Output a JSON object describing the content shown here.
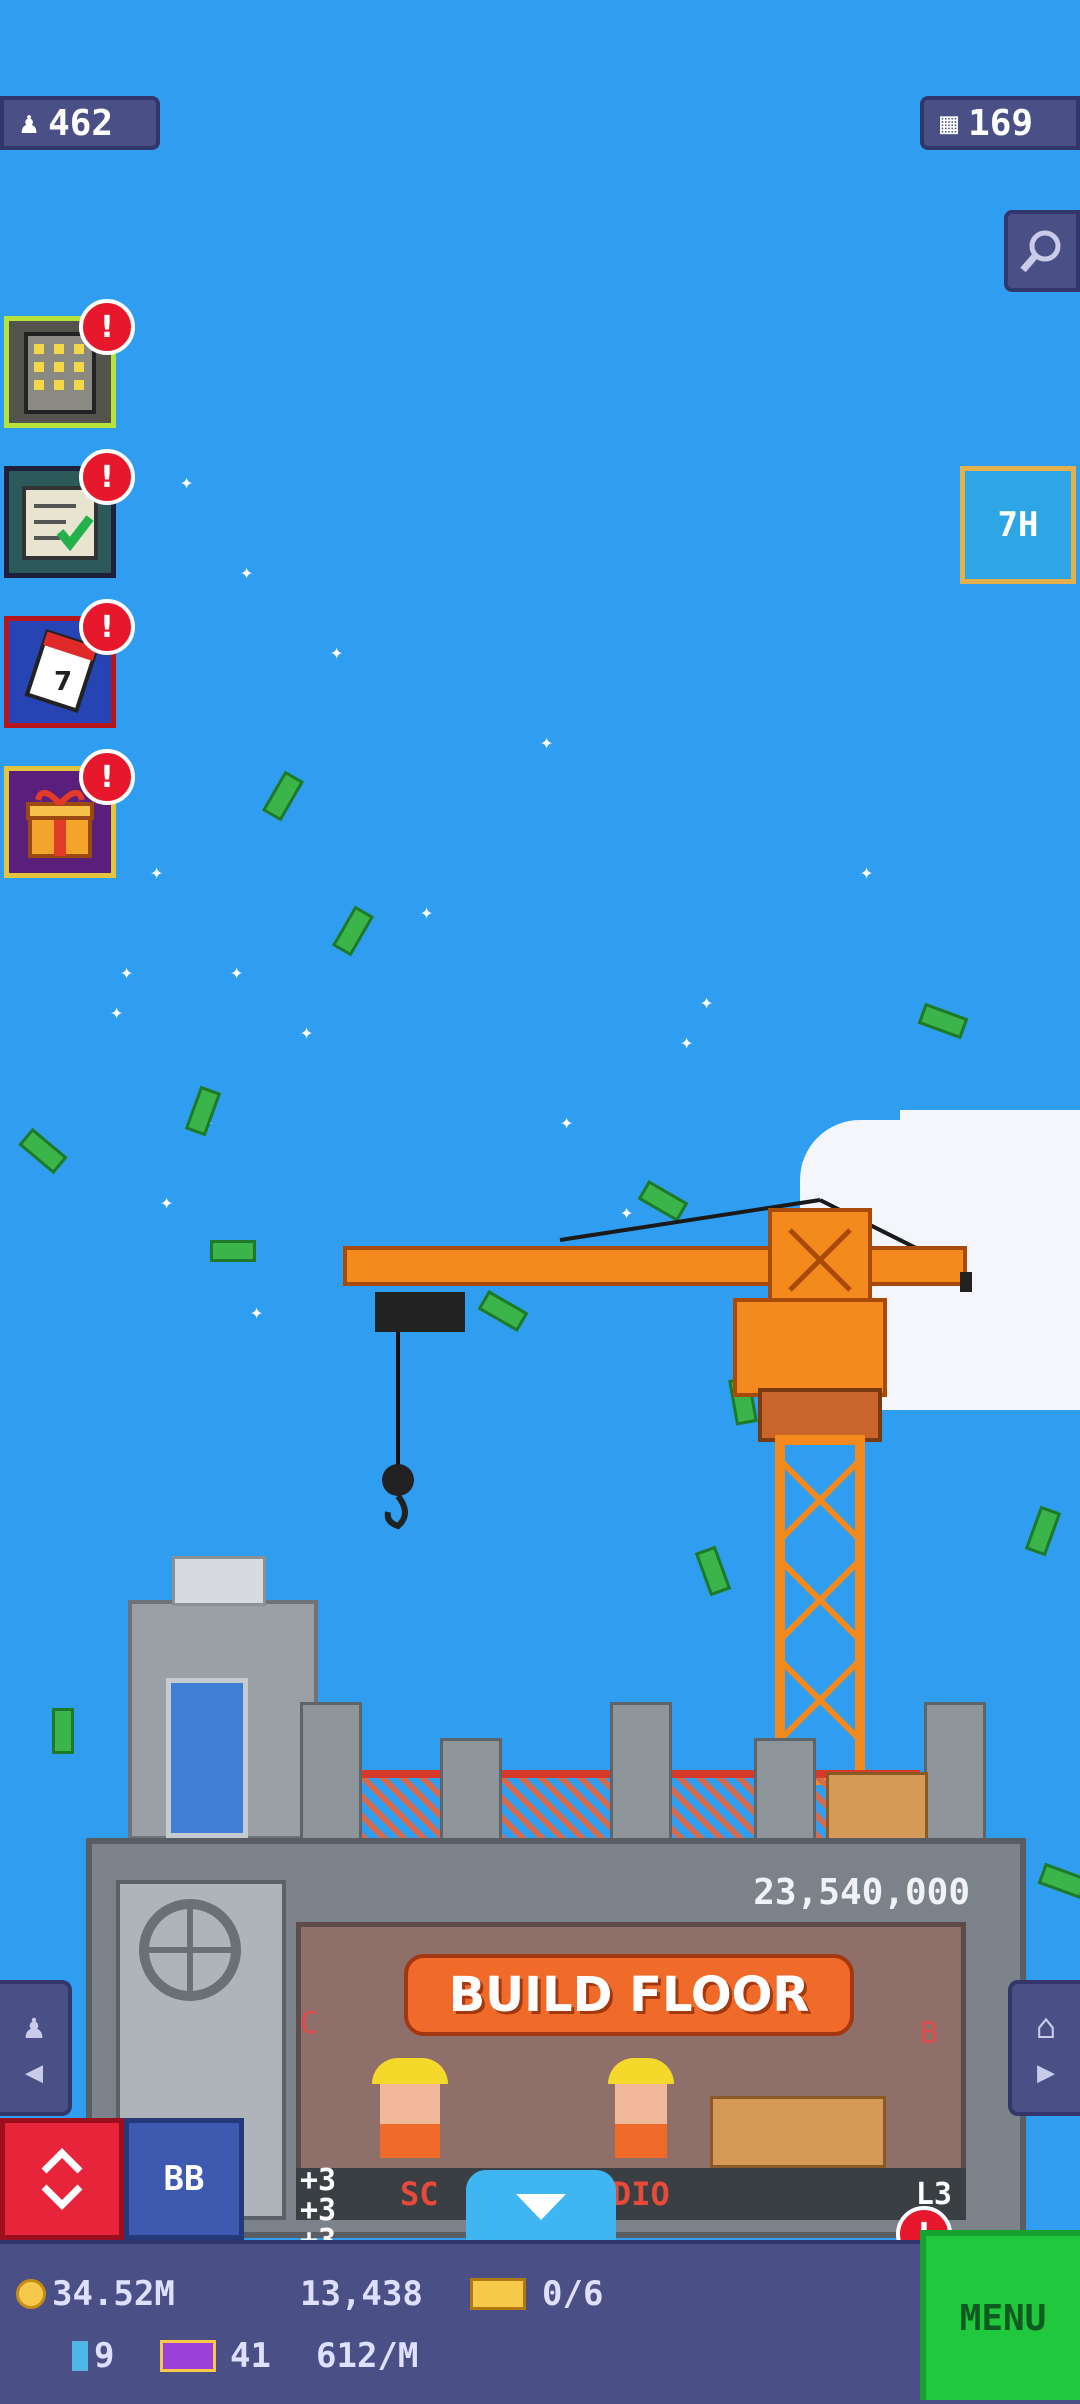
{
  "top": {
    "residents": "462",
    "floors": "169",
    "timer_label": "7H"
  },
  "build": {
    "cost": "23,540,000",
    "button_label": "BUILD FLOOR",
    "floor_label": "SC    S STUDIO",
    "floor_level": "L3",
    "left_letter": "C",
    "right_letter": "B"
  },
  "popups": [
    "+3",
    "+3",
    "+3"
  ],
  "elevator": {
    "label": "BB"
  },
  "bottom": {
    "coins": "34.52M",
    "bux": "13,438",
    "golden": "0/6",
    "tickets": "9",
    "vip": "41",
    "income": "612/M",
    "menu_label": "MENU"
  },
  "colors": {
    "sky": "#2f9ef0",
    "panel": "#4a4f86",
    "accent_orange": "#f06a2a",
    "menu_green": "#1fc83c"
  },
  "icons": {
    "residents": "person-icon",
    "floors": "building-icon",
    "zoom": "magnifier-icon",
    "elevator": "up-down-arrows-icon",
    "down": "chevron-down-icon"
  }
}
